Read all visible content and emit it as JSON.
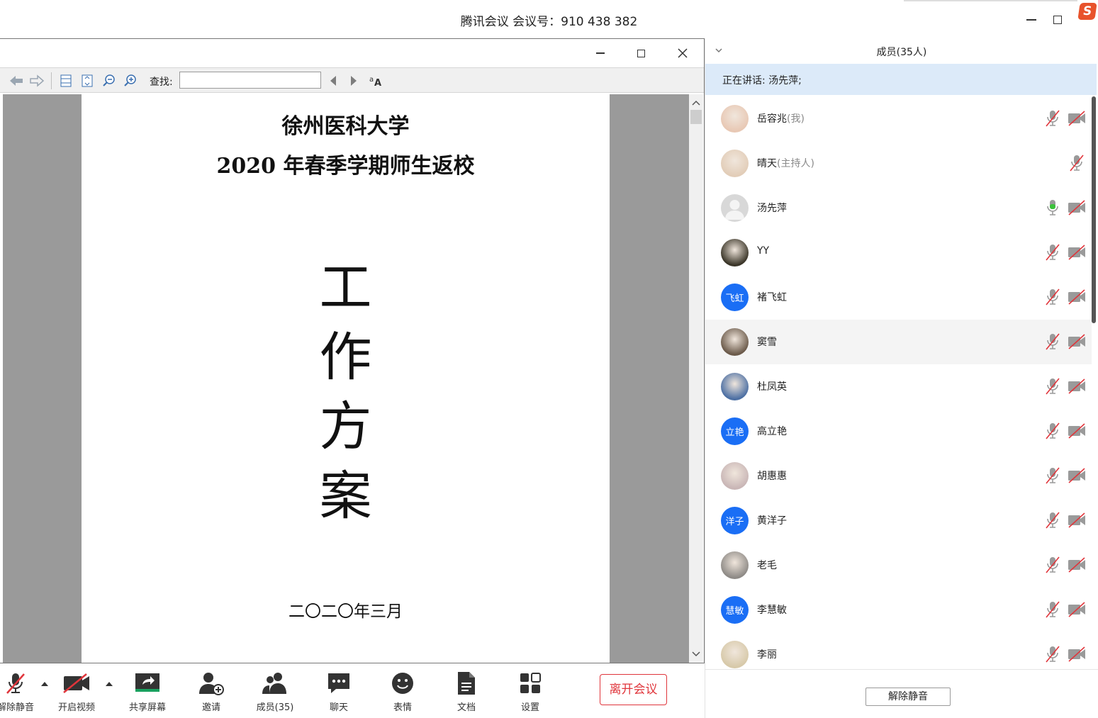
{
  "titlebar": {
    "title": "腾讯会议 会议号：910 438 382",
    "brand": "S"
  },
  "doc_viewer": {
    "toolbar": {
      "find_label": "查找:",
      "find_value": ""
    },
    "page": {
      "title_line1": "徐州医科大学",
      "title_line2": "2020 年春季学期师生返校",
      "big_chars": [
        "工",
        "作",
        "方",
        "案"
      ],
      "date": "二〇二〇年三月"
    }
  },
  "meeting_bar": {
    "items": [
      {
        "label": "解除静音",
        "icon": "mic-muted-icon"
      },
      {
        "label": "开启视频",
        "icon": "camera-off-icon"
      },
      {
        "label": "共享屏幕",
        "icon": "share-screen-icon"
      },
      {
        "label": "邀请",
        "icon": "invite-icon"
      },
      {
        "label": "成员(35)",
        "icon": "members-icon"
      },
      {
        "label": "聊天",
        "icon": "chat-icon"
      },
      {
        "label": "表情",
        "icon": "emoji-icon"
      },
      {
        "label": "文档",
        "icon": "document-icon"
      },
      {
        "label": "设置",
        "icon": "settings-icon"
      }
    ],
    "leave_label": "离开会议",
    "leave_color": "#e0353b"
  },
  "members_panel": {
    "title": "成员(35人)",
    "speaking_text": "正在讲话: 汤先萍;",
    "accent": "#1a6ef5",
    "members": [
      {
        "name": "岳容兆",
        "tag": "(我)",
        "avatar_type": "photo",
        "avatar_color": "#e8c8b4",
        "mic": "muted",
        "camera": "off"
      },
      {
        "name": "晴天",
        "tag": "(主持人)",
        "avatar_type": "photo",
        "avatar_color": "#e2cdb8",
        "mic": "muted",
        "camera": "none"
      },
      {
        "name": "汤先萍",
        "tag": "",
        "avatar_type": "default",
        "avatar_color": "#d8d8d8",
        "mic": "active",
        "camera": "off"
      },
      {
        "name": "YY",
        "tag": "",
        "avatar_type": "photo",
        "avatar_color": "#3a3528",
        "mic": "muted",
        "camera": "off"
      },
      {
        "name": "褚飞虹",
        "tag": "",
        "avatar_type": "text",
        "avatar_text": "飞虹",
        "avatar_color": "#1a6ef5",
        "mic": "muted",
        "camera": "off"
      },
      {
        "name": "窦雪",
        "tag": "",
        "avatar_type": "photo",
        "avatar_color": "#6b5a4a",
        "mic": "muted",
        "camera": "off"
      },
      {
        "name": "杜凤英",
        "tag": "",
        "avatar_type": "photo",
        "avatar_color": "#4c6fa3",
        "mic": "muted",
        "camera": "off"
      },
      {
        "name": "高立艳",
        "tag": "",
        "avatar_type": "text",
        "avatar_text": "立艳",
        "avatar_color": "#1a6ef5",
        "mic": "muted",
        "camera": "off"
      },
      {
        "name": "胡惠惠",
        "tag": "",
        "avatar_type": "photo",
        "avatar_color": "#c9b6b6",
        "mic": "muted",
        "camera": "off"
      },
      {
        "name": "黄洋子",
        "tag": "",
        "avatar_type": "text",
        "avatar_text": "洋子",
        "avatar_color": "#1a6ef5",
        "mic": "muted",
        "camera": "off"
      },
      {
        "name": "老毛",
        "tag": "",
        "avatar_type": "photo",
        "avatar_color": "#8e8a86",
        "mic": "muted",
        "camera": "off"
      },
      {
        "name": "李慧敏",
        "tag": "",
        "avatar_type": "text",
        "avatar_text": "慧敏",
        "avatar_color": "#1a6ef5",
        "mic": "muted",
        "camera": "off"
      },
      {
        "name": "李丽",
        "tag": "",
        "avatar_type": "photo",
        "avatar_color": "#d7c9a9",
        "mic": "muted",
        "camera": "off"
      }
    ],
    "unmute_all_label": "解除静音"
  }
}
